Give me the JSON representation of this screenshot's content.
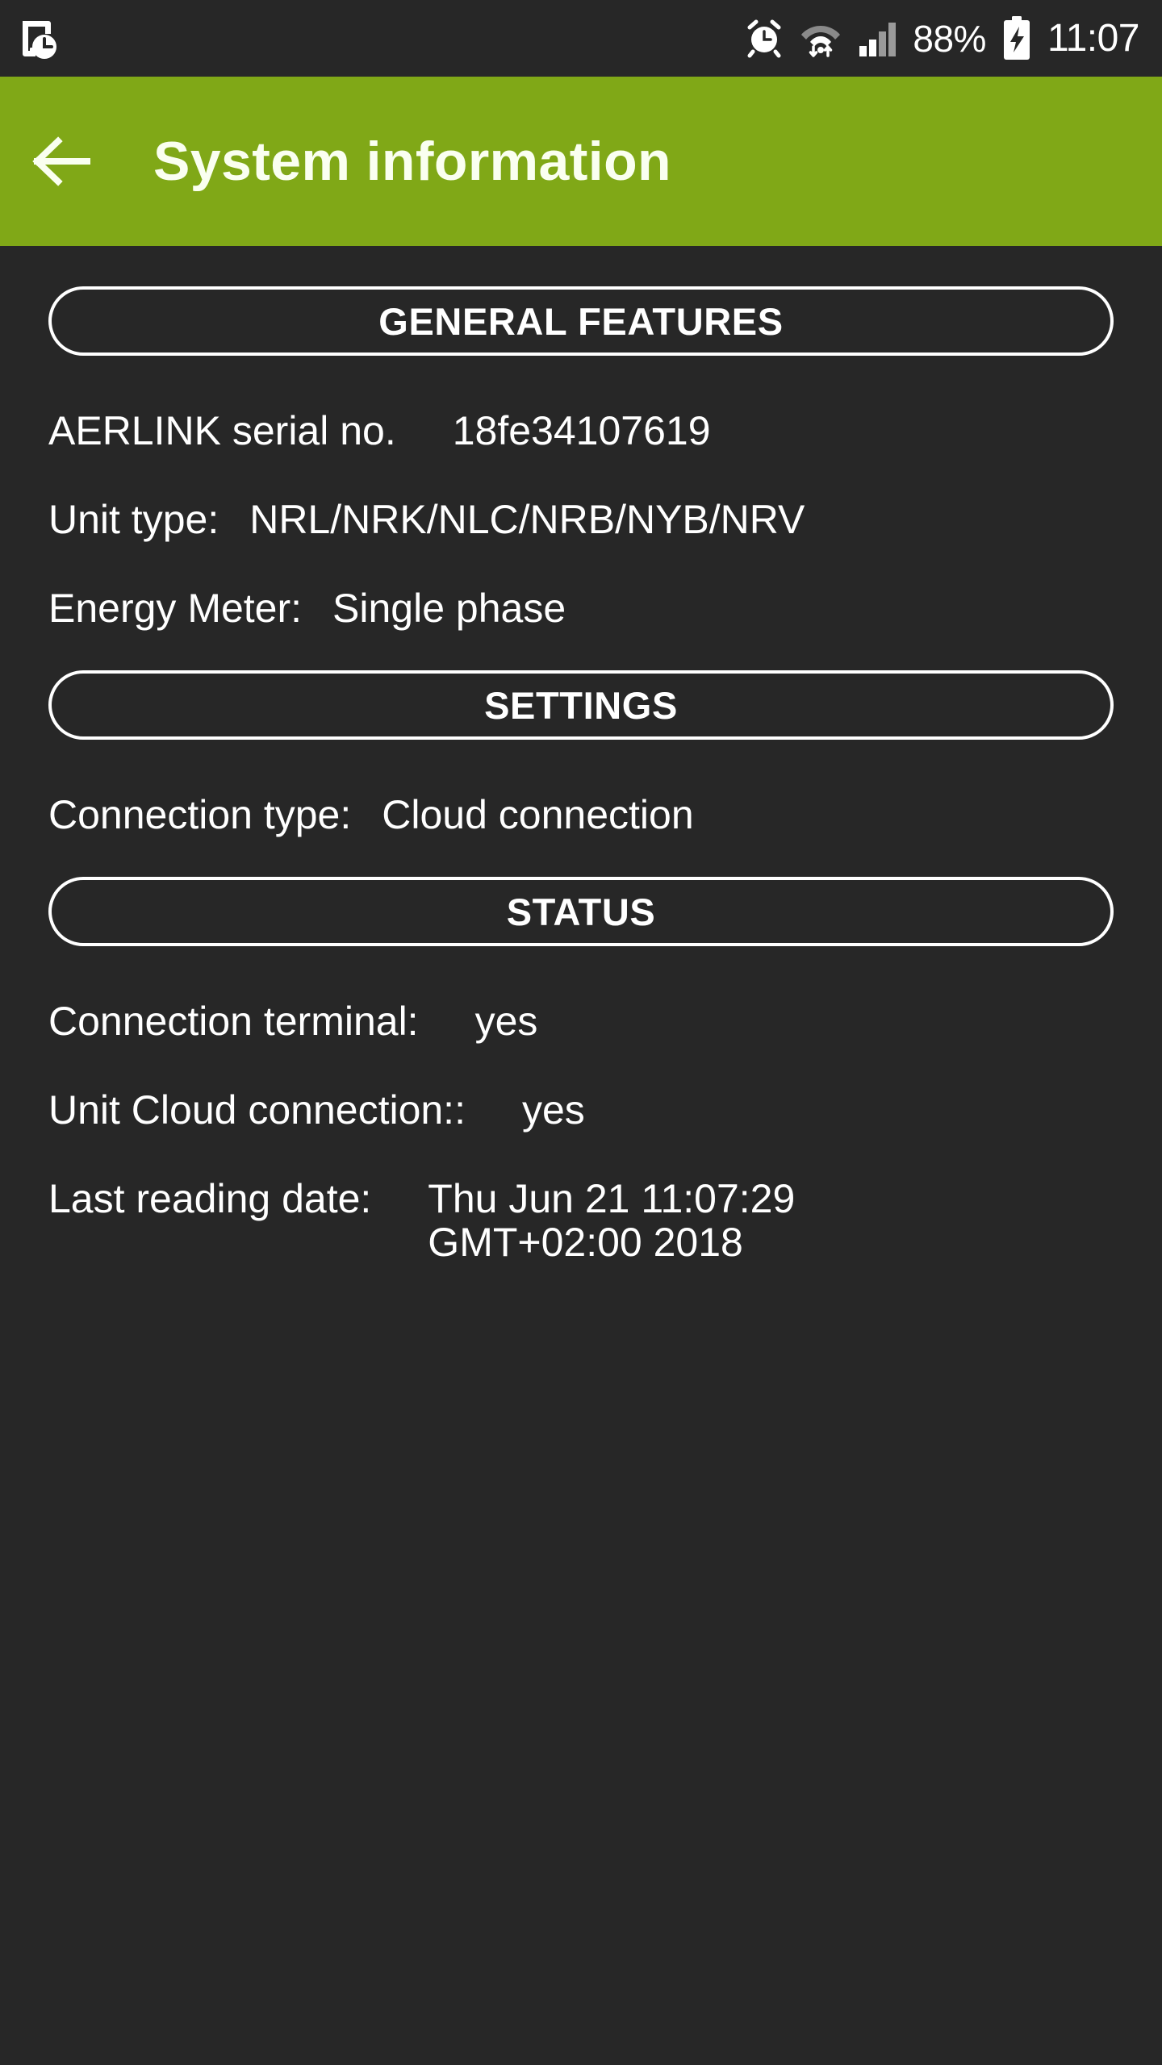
{
  "statusbar": {
    "notification_icon": "screen-time-document-clock-icon",
    "alarm_icon": "alarm-clock-icon",
    "wifi_icon": "wifi-data-transfer-icon",
    "signal_icon": "cellular-signal-icon",
    "battery_percent": "88%",
    "battery_icon": "battery-charging-icon",
    "clock": "11:07",
    "background_color": "#272727",
    "text_color": "#ffffff"
  },
  "appbar": {
    "back_icon": "back-arrow-icon",
    "title": "System information",
    "background_color": "#80A817",
    "title_color": "#FAFFF0"
  },
  "sections": [
    {
      "heading": "GENERAL FEATURES",
      "rows": [
        {
          "label": "AERLINK serial no.",
          "value": "18fe34107619",
          "gap": "wide"
        },
        {
          "label": "Unit type:",
          "value": "NRL/NRK/NLC/NRB/NYB/NRV",
          "gap": "normal"
        },
        {
          "label": "Energy Meter:",
          "value": "Single phase",
          "gap": "normal"
        }
      ]
    },
    {
      "heading": "SETTINGS",
      "rows": [
        {
          "label": "Connection type:",
          "value": "Cloud connection",
          "gap": "normal"
        }
      ]
    },
    {
      "heading": "STATUS",
      "rows": [
        {
          "label": "Connection terminal:",
          "value": "yes",
          "gap": "normal"
        },
        {
          "label": "Unit Cloud connection::",
          "value": "yes",
          "gap": "normal"
        },
        {
          "label": "Last reading date:",
          "value": "Thu Jun 21 11:07:29\nGMT+02:00 2018",
          "gap": "normal"
        }
      ]
    }
  ],
  "colors": {
    "page_background": "#272727",
    "accent_green": "#80A817",
    "text_primary": "#ffffff"
  }
}
